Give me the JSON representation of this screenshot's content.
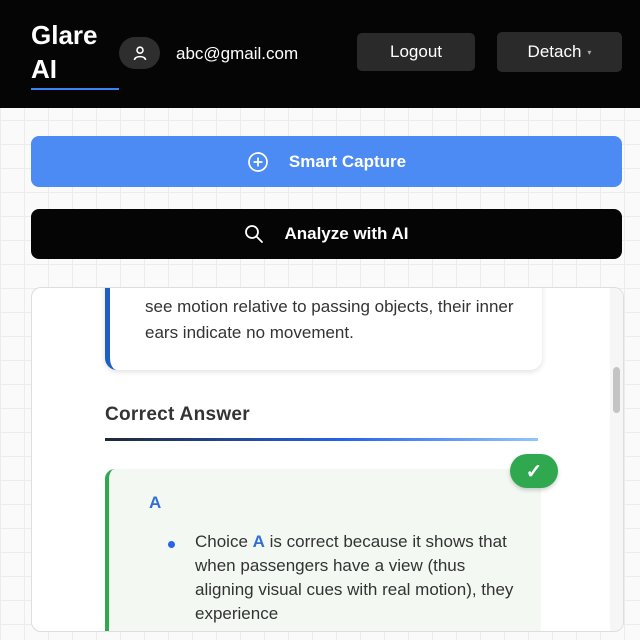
{
  "header": {
    "logo": "Glare AI",
    "user_icon": "user-icon",
    "email": "abc@gmail.com",
    "logout_label": "Logout",
    "detach_label": "Detach",
    "detach_icon": "caret-down-icon"
  },
  "actions": {
    "capture_label": "Smart Capture",
    "capture_icon": "plus-circle-icon",
    "analyze_label": "Analyze with AI",
    "analyze_icon": "search-icon"
  },
  "result": {
    "explanation_text": "see motion relative to passing objects, their inner ears indicate no movement.",
    "section_title": "Correct Answer",
    "answer_letter": "A",
    "answer_pre": "Choice ",
    "answer_highlight": "A",
    "answer_post": " is correct because it shows that when passengers have a view (thus aligning visual cues with real motion), they experience",
    "check_icon": "check-icon"
  },
  "colors": {
    "accent_blue": "#4c8af4",
    "correct_green": "#2fa84f",
    "header_bg": "#050505"
  }
}
